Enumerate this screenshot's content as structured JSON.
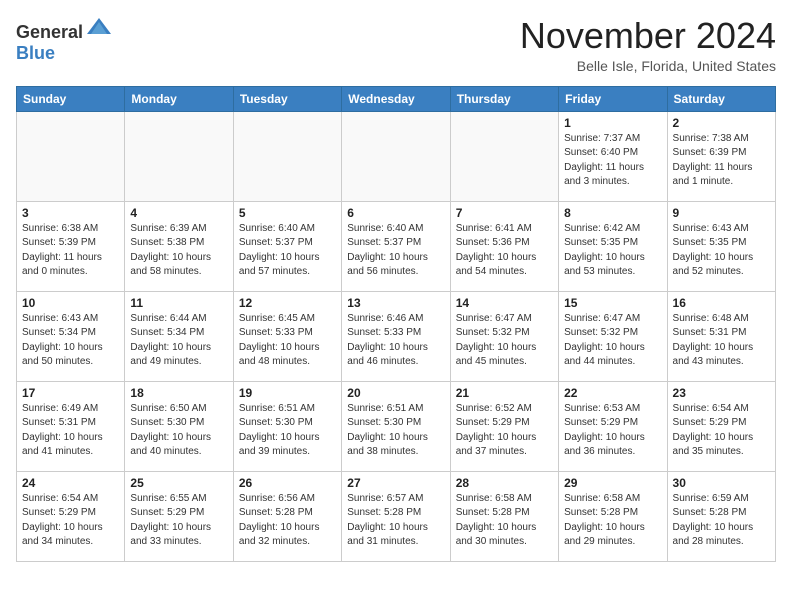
{
  "header": {
    "logo_general": "General",
    "logo_blue": "Blue",
    "month_title": "November 2024",
    "location": "Belle Isle, Florida, United States"
  },
  "days_of_week": [
    "Sunday",
    "Monday",
    "Tuesday",
    "Wednesday",
    "Thursday",
    "Friday",
    "Saturday"
  ],
  "weeks": [
    [
      {
        "day": "",
        "info": ""
      },
      {
        "day": "",
        "info": ""
      },
      {
        "day": "",
        "info": ""
      },
      {
        "day": "",
        "info": ""
      },
      {
        "day": "",
        "info": ""
      },
      {
        "day": "1",
        "info": "Sunrise: 7:37 AM\nSunset: 6:40 PM\nDaylight: 11 hours and 3 minutes."
      },
      {
        "day": "2",
        "info": "Sunrise: 7:38 AM\nSunset: 6:39 PM\nDaylight: 11 hours and 1 minute."
      }
    ],
    [
      {
        "day": "3",
        "info": "Sunrise: 6:38 AM\nSunset: 5:39 PM\nDaylight: 11 hours and 0 minutes."
      },
      {
        "day": "4",
        "info": "Sunrise: 6:39 AM\nSunset: 5:38 PM\nDaylight: 10 hours and 58 minutes."
      },
      {
        "day": "5",
        "info": "Sunrise: 6:40 AM\nSunset: 5:37 PM\nDaylight: 10 hours and 57 minutes."
      },
      {
        "day": "6",
        "info": "Sunrise: 6:40 AM\nSunset: 5:37 PM\nDaylight: 10 hours and 56 minutes."
      },
      {
        "day": "7",
        "info": "Sunrise: 6:41 AM\nSunset: 5:36 PM\nDaylight: 10 hours and 54 minutes."
      },
      {
        "day": "8",
        "info": "Sunrise: 6:42 AM\nSunset: 5:35 PM\nDaylight: 10 hours and 53 minutes."
      },
      {
        "day": "9",
        "info": "Sunrise: 6:43 AM\nSunset: 5:35 PM\nDaylight: 10 hours and 52 minutes."
      }
    ],
    [
      {
        "day": "10",
        "info": "Sunrise: 6:43 AM\nSunset: 5:34 PM\nDaylight: 10 hours and 50 minutes."
      },
      {
        "day": "11",
        "info": "Sunrise: 6:44 AM\nSunset: 5:34 PM\nDaylight: 10 hours and 49 minutes."
      },
      {
        "day": "12",
        "info": "Sunrise: 6:45 AM\nSunset: 5:33 PM\nDaylight: 10 hours and 48 minutes."
      },
      {
        "day": "13",
        "info": "Sunrise: 6:46 AM\nSunset: 5:33 PM\nDaylight: 10 hours and 46 minutes."
      },
      {
        "day": "14",
        "info": "Sunrise: 6:47 AM\nSunset: 5:32 PM\nDaylight: 10 hours and 45 minutes."
      },
      {
        "day": "15",
        "info": "Sunrise: 6:47 AM\nSunset: 5:32 PM\nDaylight: 10 hours and 44 minutes."
      },
      {
        "day": "16",
        "info": "Sunrise: 6:48 AM\nSunset: 5:31 PM\nDaylight: 10 hours and 43 minutes."
      }
    ],
    [
      {
        "day": "17",
        "info": "Sunrise: 6:49 AM\nSunset: 5:31 PM\nDaylight: 10 hours and 41 minutes."
      },
      {
        "day": "18",
        "info": "Sunrise: 6:50 AM\nSunset: 5:30 PM\nDaylight: 10 hours and 40 minutes."
      },
      {
        "day": "19",
        "info": "Sunrise: 6:51 AM\nSunset: 5:30 PM\nDaylight: 10 hours and 39 minutes."
      },
      {
        "day": "20",
        "info": "Sunrise: 6:51 AM\nSunset: 5:30 PM\nDaylight: 10 hours and 38 minutes."
      },
      {
        "day": "21",
        "info": "Sunrise: 6:52 AM\nSunset: 5:29 PM\nDaylight: 10 hours and 37 minutes."
      },
      {
        "day": "22",
        "info": "Sunrise: 6:53 AM\nSunset: 5:29 PM\nDaylight: 10 hours and 36 minutes."
      },
      {
        "day": "23",
        "info": "Sunrise: 6:54 AM\nSunset: 5:29 PM\nDaylight: 10 hours and 35 minutes."
      }
    ],
    [
      {
        "day": "24",
        "info": "Sunrise: 6:54 AM\nSunset: 5:29 PM\nDaylight: 10 hours and 34 minutes."
      },
      {
        "day": "25",
        "info": "Sunrise: 6:55 AM\nSunset: 5:29 PM\nDaylight: 10 hours and 33 minutes."
      },
      {
        "day": "26",
        "info": "Sunrise: 6:56 AM\nSunset: 5:28 PM\nDaylight: 10 hours and 32 minutes."
      },
      {
        "day": "27",
        "info": "Sunrise: 6:57 AM\nSunset: 5:28 PM\nDaylight: 10 hours and 31 minutes."
      },
      {
        "day": "28",
        "info": "Sunrise: 6:58 AM\nSunset: 5:28 PM\nDaylight: 10 hours and 30 minutes."
      },
      {
        "day": "29",
        "info": "Sunrise: 6:58 AM\nSunset: 5:28 PM\nDaylight: 10 hours and 29 minutes."
      },
      {
        "day": "30",
        "info": "Sunrise: 6:59 AM\nSunset: 5:28 PM\nDaylight: 10 hours and 28 minutes."
      }
    ]
  ]
}
